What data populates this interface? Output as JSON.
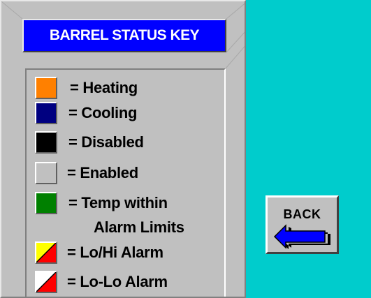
{
  "title": "BARREL STATUS KEY",
  "legend": [
    {
      "label": "= Heating",
      "color": "#ff8000",
      "icon": "orange-swatch"
    },
    {
      "label": "= Cooling",
      "color": "#000080",
      "icon": "navy-swatch"
    },
    {
      "label": "= Disabled",
      "color": "#000000",
      "icon": "black-swatch"
    },
    {
      "label": "= Enabled",
      "color": "#c0c0c0",
      "icon": "gray-swatch"
    },
    {
      "label": "= Temp within",
      "label2": "Alarm Limits",
      "color": "#008000",
      "icon": "green-swatch"
    },
    {
      "label": "= Lo/Hi Alarm",
      "color": "#ffff00",
      "color2": "#ff0000",
      "icon": "yellow-red-swatch"
    },
    {
      "label": "= Lo-Lo Alarm",
      "color": "#ffffff",
      "color2": "#ff0000",
      "icon": "white-red-swatch"
    }
  ],
  "back_button": {
    "label": "BACK",
    "icon": "left-arrow-icon",
    "arrow_color": "#0000ff"
  },
  "colors": {
    "background": "#00cccc",
    "panel": "#c0c0c0",
    "title_bg": "#0000ff"
  }
}
